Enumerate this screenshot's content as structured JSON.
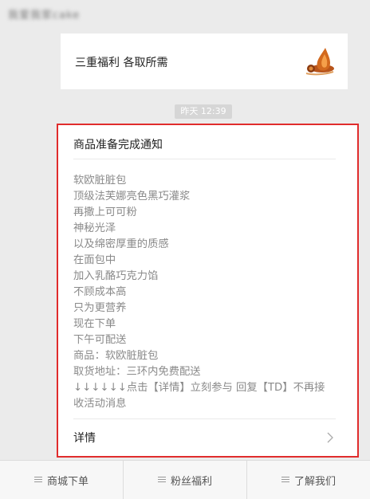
{
  "header": {
    "blurred_title": "我爱我家cake"
  },
  "promo": {
    "text": "三重福利  各取所需",
    "logo_icon": "brand-logo-icon"
  },
  "chat": {
    "timestamp": "昨天 12:39"
  },
  "notification": {
    "title": "商品准备完成通知",
    "lines": [
      "软欧脏脏包",
      "顶级法芙娜亮色黑巧灌浆",
      "再撒上可可粉",
      "神秘光泽",
      "以及绵密厚重的质感",
      "在面包中",
      "加入乳酪巧克力馅",
      "不顾成本高",
      "只为更营养",
      "现在下单",
      "下午可配送",
      "商品：软欧脏脏包",
      "取货地址：三环内免费配送",
      "↓↓↓↓↓↓点击【详情】立刻参与 回复【TD】不再接",
      "收活动消息"
    ],
    "detail_label": "详情",
    "highlight_color": "#e02c2c"
  },
  "menu": {
    "items": [
      {
        "label": "商城下单"
      },
      {
        "label": "粉丝福利"
      },
      {
        "label": "了解我们"
      }
    ]
  }
}
